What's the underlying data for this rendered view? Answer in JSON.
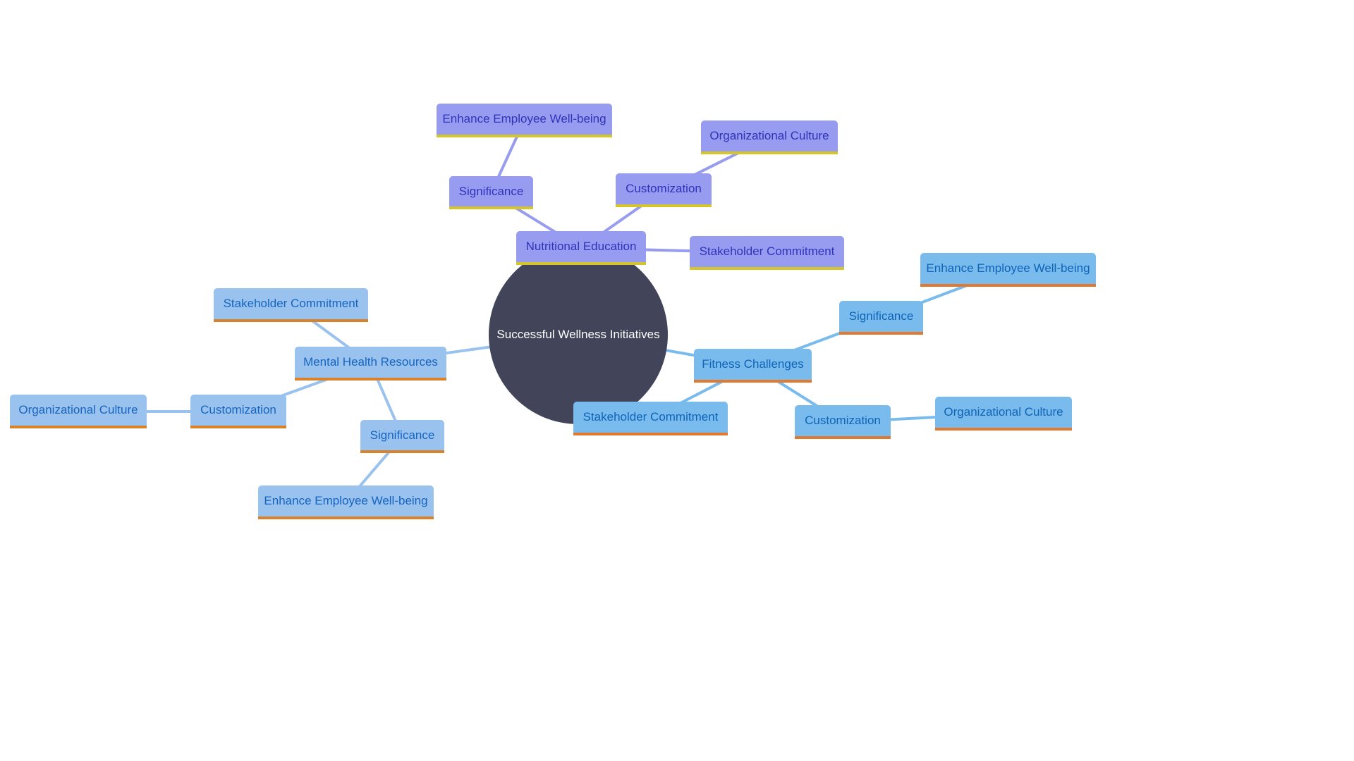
{
  "diagram": {
    "type": "mindmap",
    "root": {
      "id": "root",
      "label": "Successful Wellness Initiatives"
    },
    "colors": {
      "root_fill": "#424559",
      "root_text": "#ffffff",
      "nutrition": {
        "fill": "#979cf1",
        "text": "#2f33b8",
        "underline": "#d4c62a",
        "edge": "#979cf1"
      },
      "mental": {
        "fill": "#9ac2ee",
        "text": "#1565c0",
        "underline": "#d9822b",
        "edge": "#9ac2ee"
      },
      "fitness": {
        "fill": "#7abbee",
        "text": "#0d64b8",
        "underline": "#e07a30",
        "edge": "#7abbee"
      }
    },
    "nodes": [
      {
        "id": "nutrition",
        "label": "Nutritional Education",
        "branch": "nutrition",
        "parent": "root"
      },
      {
        "id": "nut-significance",
        "label": "Significance",
        "branch": "nutrition",
        "parent": "nutrition"
      },
      {
        "id": "nut-enhance",
        "label": "Enhance Employee Well-being",
        "branch": "nutrition",
        "parent": "nut-significance"
      },
      {
        "id": "nut-customization",
        "label": "Customization",
        "branch": "nutrition",
        "parent": "nutrition"
      },
      {
        "id": "nut-org-culture",
        "label": "Organizational Culture",
        "branch": "nutrition",
        "parent": "nut-customization"
      },
      {
        "id": "nut-stakeholder",
        "label": "Stakeholder Commitment",
        "branch": "nutrition",
        "parent": "nutrition"
      },
      {
        "id": "mental",
        "label": "Mental Health Resources",
        "branch": "mental",
        "parent": "root"
      },
      {
        "id": "men-stakeholder",
        "label": "Stakeholder Commitment",
        "branch": "mental",
        "parent": "mental"
      },
      {
        "id": "men-customization",
        "label": "Customization",
        "branch": "mental",
        "parent": "mental"
      },
      {
        "id": "men-org-culture",
        "label": "Organizational Culture",
        "branch": "mental",
        "parent": "men-customization"
      },
      {
        "id": "men-significance",
        "label": "Significance",
        "branch": "mental",
        "parent": "mental"
      },
      {
        "id": "men-enhance",
        "label": "Enhance Employee Well-being",
        "branch": "mental",
        "parent": "men-significance"
      },
      {
        "id": "fitness",
        "label": "Fitness Challenges",
        "branch": "fitness",
        "parent": "root"
      },
      {
        "id": "fit-significance",
        "label": "Significance",
        "branch": "fitness",
        "parent": "fitness"
      },
      {
        "id": "fit-enhance",
        "label": "Enhance Employee Well-being",
        "branch": "fitness",
        "parent": "fit-significance"
      },
      {
        "id": "fit-stakeholder",
        "label": "Stakeholder Commitment",
        "branch": "fitness",
        "parent": "fitness"
      },
      {
        "id": "fit-customization",
        "label": "Customization",
        "branch": "fitness",
        "parent": "fitness"
      },
      {
        "id": "fit-org-culture",
        "label": "Organizational Culture",
        "branch": "fitness",
        "parent": "fit-customization"
      }
    ]
  }
}
